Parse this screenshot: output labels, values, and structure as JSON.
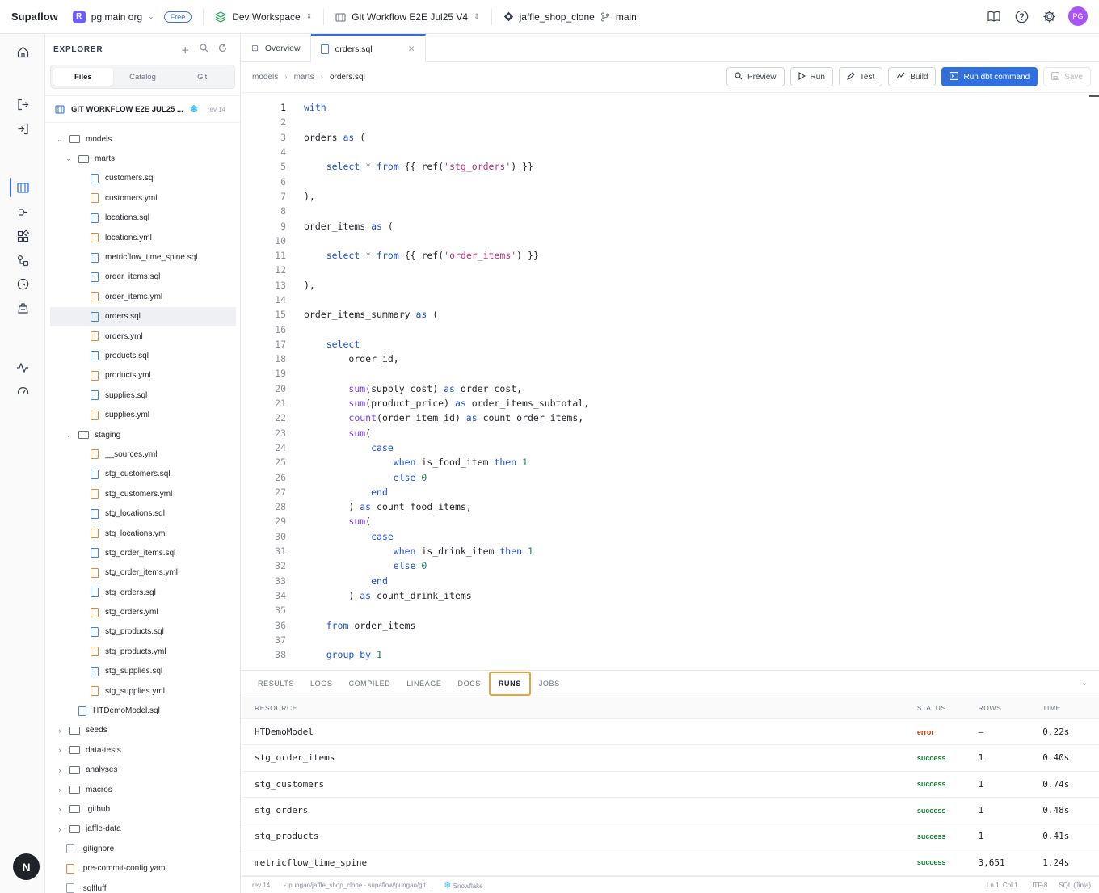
{
  "topbar": {
    "brand": "Supaflow",
    "org": "pg main org",
    "org_initial": "R",
    "plan_badge": "Free",
    "workspace": "Dev Workspace",
    "project": "Git Workflow E2E Jul25 V4",
    "repo": "jaffle_shop_clone",
    "branch": "main",
    "user_initials": "PG"
  },
  "explorer": {
    "title": "EXPLORER",
    "tabs": [
      "Files",
      "Catalog",
      "Git"
    ],
    "active_tab": "Files",
    "project_name": "GIT WORKFLOW E2E JUL25 ...",
    "project_rev": "rev 14",
    "tree": [
      {
        "depth": 0,
        "type": "folder",
        "open": true,
        "name": "models"
      },
      {
        "depth": 1,
        "type": "folder",
        "open": true,
        "name": "marts"
      },
      {
        "depth": 2,
        "type": "sql",
        "name": "customers.sql"
      },
      {
        "depth": 2,
        "type": "yml",
        "name": "customers.yml"
      },
      {
        "depth": 2,
        "type": "sql",
        "name": "locations.sql"
      },
      {
        "depth": 2,
        "type": "yml",
        "name": "locations.yml"
      },
      {
        "depth": 2,
        "type": "sql",
        "name": "metricflow_time_spine.sql"
      },
      {
        "depth": 2,
        "type": "sql",
        "name": "order_items.sql"
      },
      {
        "depth": 2,
        "type": "yml",
        "name": "order_items.yml"
      },
      {
        "depth": 2,
        "type": "sql",
        "name": "orders.sql",
        "selected": true
      },
      {
        "depth": 2,
        "type": "yml",
        "name": "orders.yml"
      },
      {
        "depth": 2,
        "type": "sql",
        "name": "products.sql"
      },
      {
        "depth": 2,
        "type": "yml",
        "name": "products.yml"
      },
      {
        "depth": 2,
        "type": "sql",
        "name": "supplies.sql"
      },
      {
        "depth": 2,
        "type": "yml",
        "name": "supplies.yml"
      },
      {
        "depth": 1,
        "type": "folder",
        "open": true,
        "name": "staging"
      },
      {
        "depth": 2,
        "type": "yml",
        "name": "__sources.yml"
      },
      {
        "depth": 2,
        "type": "sql",
        "name": "stg_customers.sql"
      },
      {
        "depth": 2,
        "type": "yml",
        "name": "stg_customers.yml"
      },
      {
        "depth": 2,
        "type": "sql",
        "name": "stg_locations.sql"
      },
      {
        "depth": 2,
        "type": "yml",
        "name": "stg_locations.yml"
      },
      {
        "depth": 2,
        "type": "sql",
        "name": "stg_order_items.sql"
      },
      {
        "depth": 2,
        "type": "yml",
        "name": "stg_order_items.yml"
      },
      {
        "depth": 2,
        "type": "sql",
        "name": "stg_orders.sql"
      },
      {
        "depth": 2,
        "type": "yml",
        "name": "stg_orders.yml"
      },
      {
        "depth": 2,
        "type": "sql",
        "name": "stg_products.sql"
      },
      {
        "depth": 2,
        "type": "yml",
        "name": "stg_products.yml"
      },
      {
        "depth": 2,
        "type": "sql",
        "name": "stg_supplies.sql"
      },
      {
        "depth": 2,
        "type": "yml",
        "name": "stg_supplies.yml"
      },
      {
        "depth": 1,
        "type": "sql",
        "name": "HTDemoModel.sql"
      },
      {
        "depth": 0,
        "type": "folder",
        "open": false,
        "name": "seeds"
      },
      {
        "depth": 0,
        "type": "folder",
        "open": false,
        "name": "data-tests"
      },
      {
        "depth": 0,
        "type": "folder",
        "open": false,
        "name": "analyses"
      },
      {
        "depth": 0,
        "type": "folder",
        "open": false,
        "name": "macros"
      },
      {
        "depth": 0,
        "type": "folder",
        "open": false,
        "name": ".github"
      },
      {
        "depth": 0,
        "type": "folder",
        "open": false,
        "name": "jaffle-data"
      },
      {
        "depth": 0,
        "type": "plain",
        "name": ".gitignore"
      },
      {
        "depth": 0,
        "type": "yml",
        "name": ".pre-commit-config.yaml"
      },
      {
        "depth": 0,
        "type": "plain",
        "name": ".sqlfluff"
      }
    ]
  },
  "tabs": [
    {
      "label": "Overview",
      "active": false
    },
    {
      "label": "orders.sql",
      "active": true
    }
  ],
  "breadcrumb": [
    "models",
    "marts",
    "orders.sql"
  ],
  "actions": {
    "preview": "Preview",
    "run": "Run",
    "test": "Test",
    "build": "Build",
    "run_dbt": "Run dbt command",
    "save": "Save"
  },
  "code": [
    [
      {
        "t": "with",
        "c": "kw"
      }
    ],
    [],
    [
      {
        "t": "orders "
      },
      {
        "t": "as",
        "c": "kw"
      },
      {
        "t": " ("
      }
    ],
    [],
    [
      {
        "t": "    "
      },
      {
        "t": "select",
        "c": "kw"
      },
      {
        "t": " "
      },
      {
        "t": "*",
        "c": "op"
      },
      {
        "t": " "
      },
      {
        "t": "from",
        "c": "kw"
      },
      {
        "t": " {{ ref("
      },
      {
        "t": "'stg_orders'",
        "c": "str"
      },
      {
        "t": ") }}"
      }
    ],
    [],
    [
      {
        "t": "),"
      }
    ],
    [],
    [
      {
        "t": "order_items "
      },
      {
        "t": "as",
        "c": "kw"
      },
      {
        "t": " ("
      }
    ],
    [],
    [
      {
        "t": "    "
      },
      {
        "t": "select",
        "c": "kw"
      },
      {
        "t": " "
      },
      {
        "t": "*",
        "c": "op"
      },
      {
        "t": " "
      },
      {
        "t": "from",
        "c": "kw"
      },
      {
        "t": " {{ ref("
      },
      {
        "t": "'order_items'",
        "c": "str"
      },
      {
        "t": ") }}"
      }
    ],
    [],
    [
      {
        "t": "),"
      }
    ],
    [],
    [
      {
        "t": "order_items_summary "
      },
      {
        "t": "as",
        "c": "kw"
      },
      {
        "t": " ("
      }
    ],
    [],
    [
      {
        "t": "    "
      },
      {
        "t": "select",
        "c": "kw"
      }
    ],
    [
      {
        "t": "        order_id,"
      }
    ],
    [],
    [
      {
        "t": "        "
      },
      {
        "t": "sum",
        "c": "fn"
      },
      {
        "t": "(supply_cost) "
      },
      {
        "t": "as",
        "c": "kw"
      },
      {
        "t": " order_cost,"
      }
    ],
    [
      {
        "t": "        "
      },
      {
        "t": "sum",
        "c": "fn"
      },
      {
        "t": "(product_price) "
      },
      {
        "t": "as",
        "c": "kw"
      },
      {
        "t": " order_items_subtotal,"
      }
    ],
    [
      {
        "t": "        "
      },
      {
        "t": "count",
        "c": "fn"
      },
      {
        "t": "(order_item_id) "
      },
      {
        "t": "as",
        "c": "kw"
      },
      {
        "t": " count_order_items,"
      }
    ],
    [
      {
        "t": "        "
      },
      {
        "t": "sum",
        "c": "fn"
      },
      {
        "t": "("
      }
    ],
    [
      {
        "t": "            "
      },
      {
        "t": "case",
        "c": "kw"
      }
    ],
    [
      {
        "t": "                "
      },
      {
        "t": "when",
        "c": "kw"
      },
      {
        "t": " is_food_item "
      },
      {
        "t": "then",
        "c": "kw"
      },
      {
        "t": " "
      },
      {
        "t": "1",
        "c": "num"
      }
    ],
    [
      {
        "t": "                "
      },
      {
        "t": "else",
        "c": "kw"
      },
      {
        "t": " "
      },
      {
        "t": "0",
        "c": "num"
      }
    ],
    [
      {
        "t": "            "
      },
      {
        "t": "end",
        "c": "kw"
      }
    ],
    [
      {
        "t": "        ) "
      },
      {
        "t": "as",
        "c": "kw"
      },
      {
        "t": " count_food_items,"
      }
    ],
    [
      {
        "t": "        "
      },
      {
        "t": "sum",
        "c": "fn"
      },
      {
        "t": "("
      }
    ],
    [
      {
        "t": "            "
      },
      {
        "t": "case",
        "c": "kw"
      }
    ],
    [
      {
        "t": "                "
      },
      {
        "t": "when",
        "c": "kw"
      },
      {
        "t": " is_drink_item "
      },
      {
        "t": "then",
        "c": "kw"
      },
      {
        "t": " "
      },
      {
        "t": "1",
        "c": "num"
      }
    ],
    [
      {
        "t": "                "
      },
      {
        "t": "else",
        "c": "kw"
      },
      {
        "t": " "
      },
      {
        "t": "0",
        "c": "num"
      }
    ],
    [
      {
        "t": "            "
      },
      {
        "t": "end",
        "c": "kw"
      }
    ],
    [
      {
        "t": "        ) "
      },
      {
        "t": "as",
        "c": "kw"
      },
      {
        "t": " count_drink_items"
      }
    ],
    [],
    [
      {
        "t": "    "
      },
      {
        "t": "from",
        "c": "kw"
      },
      {
        "t": " order_items"
      }
    ],
    [],
    [
      {
        "t": "    "
      },
      {
        "t": "group by",
        "c": "kw"
      },
      {
        "t": " "
      },
      {
        "t": "1",
        "c": "num"
      }
    ]
  ],
  "panel": {
    "tabs": [
      "RESULTS",
      "LOGS",
      "COMPILED",
      "LINEAGE",
      "DOCS",
      "RUNS",
      "JOBS"
    ],
    "active_tab": "RUNS",
    "headers": {
      "resource": "RESOURCE",
      "status": "STATUS",
      "rows": "ROWS",
      "time": "TIME"
    },
    "runs": [
      {
        "resource": "HTDemoModel",
        "status": "error",
        "rows": "—",
        "time": "0.22s"
      },
      {
        "resource": "stg_order_items",
        "status": "success",
        "rows": "1",
        "time": "0.40s"
      },
      {
        "resource": "stg_customers",
        "status": "success",
        "rows": "1",
        "time": "0.74s"
      },
      {
        "resource": "stg_orders",
        "status": "success",
        "rows": "1",
        "time": "0.48s"
      },
      {
        "resource": "stg_products",
        "status": "success",
        "rows": "1",
        "time": "0.41s"
      },
      {
        "resource": "metricflow_time_spine",
        "status": "success",
        "rows": "3,651",
        "time": "1.24s"
      }
    ]
  },
  "statusbar": {
    "rev": "rev 14",
    "path": "pungao/jaffle_shop_clone · supaflow/pungao/git...",
    "warehouse": "Snowflake",
    "cursor": "Ln 1, Col 1",
    "encoding": "UTF-8",
    "language": "SQL (Jinja)"
  },
  "colors": {
    "accent": "#2f6fe0",
    "error": "#c2410c",
    "success": "#15803d",
    "runs_highlight": "#e8a33d"
  }
}
